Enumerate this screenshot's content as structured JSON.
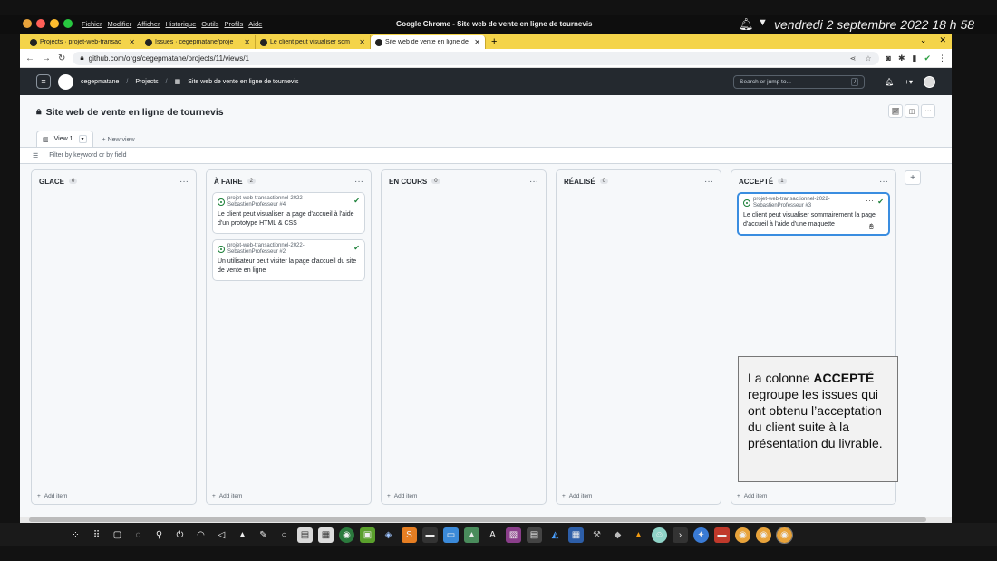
{
  "os": {
    "app_title": "Google Chrome - Site web de vente en ligne de tournevis",
    "menu": [
      "Fichier",
      "Modifier",
      "Afficher",
      "Historique",
      "Outils",
      "Profils",
      "Aide"
    ],
    "clock": "vendredi 2 septembre 2022  18 h 58",
    "traffic_colors": [
      "#ff5f57",
      "#febc2e",
      "#28c840"
    ]
  },
  "browser": {
    "tabs": [
      {
        "label": "Projects · projet-web-transac",
        "icon": "github-icon"
      },
      {
        "label": "Issues · cegepmatane/proje",
        "icon": "github-icon"
      },
      {
        "label": "Le client peut visualiser som",
        "icon": "github-icon"
      },
      {
        "label": "Site web de vente en ligne de",
        "icon": "github-icon",
        "active": true
      }
    ],
    "new_tab": "+",
    "url": "github.com/orgs/cegepmatane/projects/11/views/1"
  },
  "github": {
    "org": "cegepmatane",
    "projects": "Projects",
    "project_name": "Site web de vente en ligne de tournevis",
    "search_placeholder": "Search or jump to...",
    "search_key": "/"
  },
  "project": {
    "title": "Site web de vente en ligne de tournevis",
    "view_label": "View 1",
    "new_view": "New view",
    "filter_placeholder": "Filter by keyword or by field",
    "add_item": "Add item",
    "columns": [
      {
        "name": "GLACE",
        "count": "0",
        "cards": []
      },
      {
        "name": "À FAIRE",
        "count": "2",
        "cards": [
          {
            "repo": "projet-web-transactionnel-2022-SebastienProfesseur #4",
            "title": "Le client peut visualiser la page d'accueil à l'aide d'un prototype HTML & CSS"
          },
          {
            "repo": "projet-web-transactionnel-2022-SebastienProfesseur #2",
            "title": "Un utilisateur peut visiter la page d'accueil du site de vente en ligne"
          }
        ]
      },
      {
        "name": "EN COURS",
        "count": "0",
        "cards": []
      },
      {
        "name": "RÉALISÉ",
        "count": "0",
        "cards": []
      },
      {
        "name": "ACCEPTÉ",
        "count": "1",
        "cards": [
          {
            "repo": "projet-web-transactionnel-2022-SebastienProfesseur #3",
            "title": "Le client peut visualiser sommairement la page d'accueil à l'aide d'une maquette"
          }
        ]
      }
    ]
  },
  "callout": {
    "before": "La colonne ",
    "bold": "ACCEPTÉ",
    "after": " regroupe les issues qui ont obtenu l’acceptation du client suite à la présentation du livrable."
  },
  "colors": {
    "tabbar": "#f4d44a",
    "gh_header": "#24292f",
    "accent_blue": "#3a8de0",
    "check_green": "#1a7f37"
  }
}
